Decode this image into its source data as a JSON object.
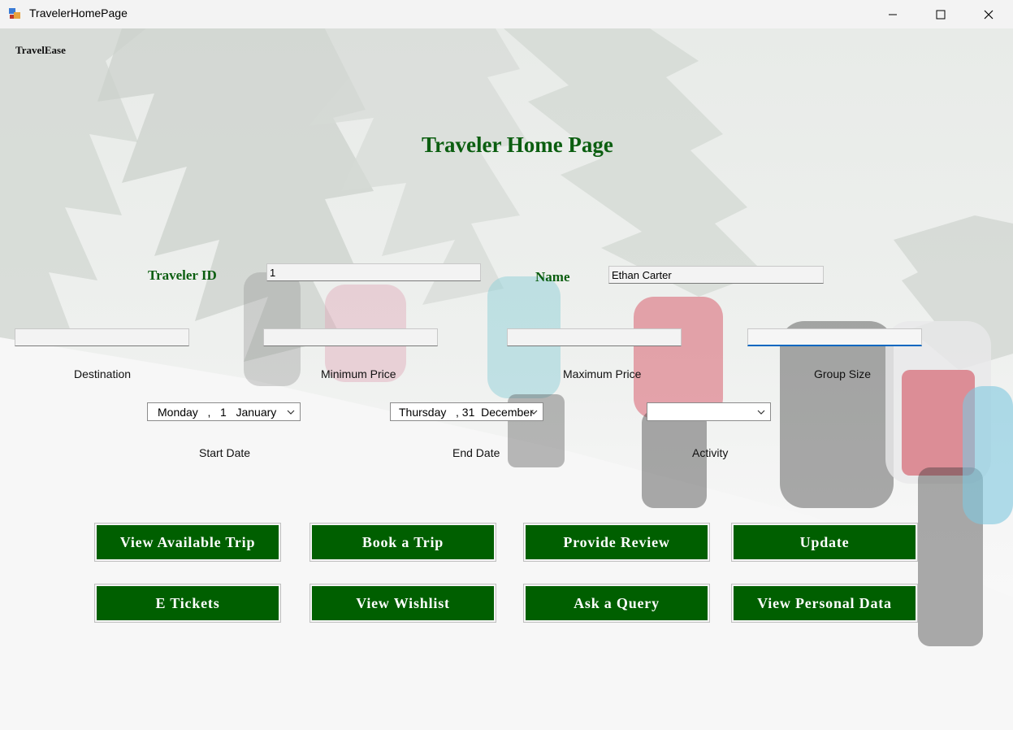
{
  "window": {
    "title": "TravelerHomePage"
  },
  "brand": "TravelEase",
  "heading": "Traveler Home Page",
  "traveler": {
    "id_label": "Traveler ID",
    "id_value": "1",
    "name_label": "Name",
    "name_value": "Ethan Carter"
  },
  "filters": {
    "destination": {
      "label": "Destination",
      "value": ""
    },
    "min_price": {
      "label": "Minimum Price",
      "value": ""
    },
    "max_price": {
      "label": "Maximum Price",
      "value": ""
    },
    "group_size": {
      "label": "Group Size",
      "value": ""
    }
  },
  "dates": {
    "start": {
      "label": "Start Date",
      "value": "Monday   ,   1   January"
    },
    "end": {
      "label": "End Date",
      "value": "Thursday   , 31  December"
    }
  },
  "activity": {
    "label": "Activity",
    "value": ""
  },
  "buttons": {
    "view_available_trip": "View Available Trip",
    "book_trip": "Book a Trip",
    "provide_review": "Provide Review",
    "update": "Update",
    "e_tickets": "E Tickets",
    "view_wishlist": "View Wishlist",
    "ask_query": "Ask a Query",
    "view_personal_data": "View Personal Data"
  },
  "colors": {
    "accent": "#005f00",
    "heading": "#0b5e10",
    "focus": "#0067c0"
  },
  "icons": {
    "app": "app-icon",
    "minimize": "minimize-icon",
    "maximize": "maximize-icon",
    "close": "close-icon",
    "dropdown": "chevron-down-icon"
  }
}
